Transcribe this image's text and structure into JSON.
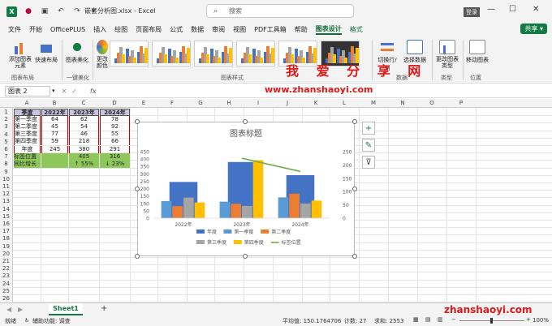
{
  "titlebar": {
    "filename": "嵌套分析图.xlsx",
    "app": "Excel",
    "search_placeholder": "搜索",
    "login": "登录"
  },
  "menu": [
    "文件",
    "开始",
    "OfficePLUS",
    "插入",
    "绘图",
    "页面布局",
    "公式",
    "数据",
    "审阅",
    "视图",
    "PDF工具箱",
    "帮助",
    "图表设计",
    "格式"
  ],
  "menu_active": "图表设计",
  "share_label": "共享",
  "ribbon": {
    "add_element": "添加图表元素",
    "quick_layout": "快速布局",
    "beautify": "图表美化",
    "change_colors": "更改颜色",
    "switch_row_col": "切换行/列",
    "select_data": "选择数据",
    "change_type": "更改图表类型",
    "move_chart": "移动图表",
    "group_layout": "图表布局",
    "group_beautify": "一键美化",
    "group_styles": "图表样式",
    "group_data": "数据",
    "group_type": "类型",
    "group_location": "位置"
  },
  "watermark": {
    "line1": "我 爱 分 享 网",
    "line2": "www.zhanshaoyi.com",
    "bottom": "zhanshaoyi.com"
  },
  "namebox": "图表 2",
  "fx": "fx",
  "columns": [
    "A",
    "B",
    "C",
    "D",
    "E",
    "F",
    "G",
    "H",
    "I",
    "J",
    "K",
    "L",
    "M",
    "N",
    "O",
    "P"
  ],
  "rows": [
    "1",
    "2",
    "3",
    "4",
    "5",
    "6",
    "7",
    "8",
    "9",
    "10",
    "11",
    "12",
    "13",
    "14",
    "15",
    "16",
    "17",
    "18",
    "19",
    "20",
    "21",
    "22",
    "23",
    "24",
    "25",
    "26"
  ],
  "table": {
    "header": [
      "季度",
      "2022年",
      "2023年",
      "2024年"
    ],
    "body": [
      [
        "第一季度",
        "64",
        "62",
        "78"
      ],
      [
        "第二季度",
        "45",
        "54",
        "92"
      ],
      [
        "第三季度",
        "77",
        "46",
        "55"
      ],
      [
        "第四季度",
        "59",
        "218",
        "66"
      ],
      [
        "年度",
        "245",
        "380",
        "291"
      ],
      [
        "标签位置",
        "",
        "405",
        "316"
      ],
      [
        "同比增长",
        "",
        "↑ 55%",
        "↓ 23%"
      ]
    ]
  },
  "sheet_tab": "Sheet1",
  "add_sheet": "+",
  "status": {
    "ready": "就绪",
    "accessibility": "辅助功能: 调查",
    "average": "平均值: 150.1764706",
    "count": "计数: 27",
    "sum": "求和: 2553",
    "zoom": "100%"
  },
  "chart_data": {
    "type": "bar",
    "title": "图表标题",
    "categories": [
      "2022年",
      "2023年",
      "2024年"
    ],
    "primary_ylim": [
      0,
      450
    ],
    "primary_yticks": [
      "0",
      "50",
      "100",
      "150",
      "200",
      "250",
      "300",
      "350",
      "400",
      "450"
    ],
    "secondary_ylim": [
      0,
      250
    ],
    "secondary_yticks": [
      "0",
      "50",
      "100",
      "150",
      "200",
      "250"
    ],
    "series": [
      {
        "name": "年度",
        "values": [
          245,
          380,
          291
        ],
        "color": "#4472c4",
        "kind": "bar-back"
      },
      {
        "name": "第一季度",
        "values": [
          64,
          62,
          78
        ],
        "color": "#5b9bd5",
        "kind": "bar"
      },
      {
        "name": "第二季度",
        "values": [
          45,
          54,
          92
        ],
        "color": "#ed7d31",
        "kind": "bar"
      },
      {
        "name": "第三季度",
        "values": [
          77,
          46,
          55
        ],
        "color": "#a5a5a5",
        "kind": "bar"
      },
      {
        "name": "第四季度",
        "values": [
          59,
          218,
          66
        ],
        "color": "#ffc000",
        "kind": "bar"
      },
      {
        "name": "标签位置",
        "values": [
          null,
          405,
          316
        ],
        "color": "#70ad47",
        "kind": "line"
      }
    ],
    "legend_position": "bottom"
  }
}
